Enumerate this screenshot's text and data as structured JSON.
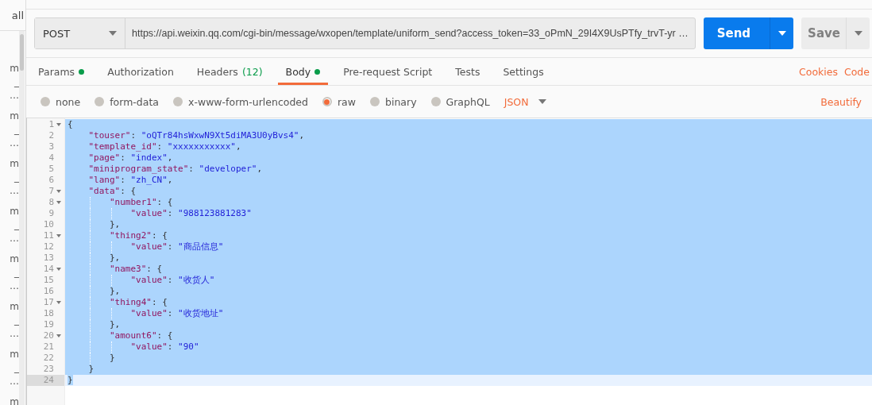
{
  "sidebar": {
    "header": "all",
    "items": [
      {
        "lines": [
          "m",
          "_",
          "…"
        ]
      },
      {
        "lines": [
          "m",
          "_",
          "…"
        ]
      },
      {
        "lines": [
          "m",
          "_",
          "…"
        ]
      },
      {
        "lines": [
          "m",
          "_",
          "…"
        ]
      },
      {
        "lines": [
          "m",
          "_",
          "…"
        ]
      },
      {
        "lines": [
          "m",
          "_",
          "…"
        ]
      },
      {
        "lines": [
          "m",
          "_",
          "…"
        ]
      },
      {
        "lines": [
          "m"
        ]
      }
    ]
  },
  "request": {
    "method": "POST",
    "url": "https://api.weixin.qq.com/cgi-bin/message/wxopen/template/uniform_send?access_token=33_oPmN_29I4X9UsPTfy_trvT-yr …",
    "send": "Send",
    "save": "Save"
  },
  "tabs": [
    {
      "label": "Params",
      "dot": true,
      "selected": false
    },
    {
      "label": "Authorization",
      "dot": false,
      "selected": false
    },
    {
      "label": "Headers",
      "count": "(12)",
      "dot": false,
      "selected": false
    },
    {
      "label": "Body",
      "dot": true,
      "selected": true
    },
    {
      "label": "Pre-request Script",
      "dot": false,
      "selected": false
    },
    {
      "label": "Tests",
      "dot": false,
      "selected": false
    },
    {
      "label": "Settings",
      "dot": false,
      "selected": false
    }
  ],
  "tab_links": [
    "Cookies",
    "Code"
  ],
  "body_types": [
    {
      "label": "none",
      "selected": false
    },
    {
      "label": "form-data",
      "selected": false
    },
    {
      "label": "x-www-form-urlencoded",
      "selected": false
    },
    {
      "label": "raw",
      "selected": true
    },
    {
      "label": "binary",
      "selected": false
    },
    {
      "label": "GraphQL",
      "selected": false
    }
  ],
  "format": "JSON",
  "beautify": "Beautify",
  "editor": {
    "lines": [
      {
        "number": "1",
        "fold": true,
        "selected": true,
        "current": false,
        "tokens": [
          {
            "kind": "punct",
            "text": "{"
          }
        ]
      },
      {
        "number": "2",
        "fold": false,
        "selected": true,
        "current": false,
        "tokens": [
          {
            "kind": "key",
            "text": "    \"touser\""
          },
          {
            "kind": "punct",
            "text": ": "
          },
          {
            "kind": "string",
            "text": "\"oQTr84hsWxwN9Xt5diMA3U0yBvs4\""
          },
          {
            "kind": "punct",
            "text": ","
          }
        ]
      },
      {
        "number": "3",
        "fold": false,
        "selected": true,
        "current": false,
        "tokens": [
          {
            "kind": "key",
            "text": "    \"template_id\""
          },
          {
            "kind": "punct",
            "text": ": "
          },
          {
            "kind": "string",
            "text": "\"xxxxxxxxxxx\""
          },
          {
            "kind": "punct",
            "text": ","
          }
        ]
      },
      {
        "number": "4",
        "fold": false,
        "selected": true,
        "current": false,
        "tokens": [
          {
            "kind": "key",
            "text": "    \"page\""
          },
          {
            "kind": "punct",
            "text": ": "
          },
          {
            "kind": "string",
            "text": "\"index\""
          },
          {
            "kind": "punct",
            "text": ","
          }
        ]
      },
      {
        "number": "5",
        "fold": false,
        "selected": true,
        "current": false,
        "tokens": [
          {
            "kind": "key",
            "text": "    \"miniprogram_state\""
          },
          {
            "kind": "punct",
            "text": ": "
          },
          {
            "kind": "string",
            "text": "\"developer\""
          },
          {
            "kind": "punct",
            "text": ","
          }
        ]
      },
      {
        "number": "6",
        "fold": false,
        "selected": true,
        "current": false,
        "tokens": [
          {
            "kind": "key",
            "text": "    \"lang\""
          },
          {
            "kind": "punct",
            "text": ": "
          },
          {
            "kind": "string",
            "text": "\"zh_CN\""
          },
          {
            "kind": "punct",
            "text": ","
          }
        ]
      },
      {
        "number": "7",
        "fold": true,
        "selected": true,
        "current": false,
        "tokens": [
          {
            "kind": "key",
            "text": "    \"data\""
          },
          {
            "kind": "punct",
            "text": ": {"
          }
        ]
      },
      {
        "number": "8",
        "fold": true,
        "selected": true,
        "current": false,
        "tokens": [
          {
            "kind": "key",
            "text": "        \"number1\""
          },
          {
            "kind": "punct",
            "text": ": {"
          }
        ]
      },
      {
        "number": "9",
        "fold": false,
        "selected": true,
        "current": false,
        "tokens": [
          {
            "kind": "key",
            "text": "            \"value\""
          },
          {
            "kind": "punct",
            "text": ": "
          },
          {
            "kind": "string",
            "text": "\"988123881283\""
          }
        ]
      },
      {
        "number": "10",
        "fold": false,
        "selected": true,
        "current": false,
        "tokens": [
          {
            "kind": "punct",
            "text": "        },"
          }
        ]
      },
      {
        "number": "11",
        "fold": true,
        "selected": true,
        "current": false,
        "tokens": [
          {
            "kind": "key",
            "text": "        \"thing2\""
          },
          {
            "kind": "punct",
            "text": ": {"
          }
        ]
      },
      {
        "number": "12",
        "fold": false,
        "selected": true,
        "current": false,
        "tokens": [
          {
            "kind": "key",
            "text": "            \"value\""
          },
          {
            "kind": "punct",
            "text": ": "
          },
          {
            "kind": "string",
            "text": "\"商品信息\""
          }
        ]
      },
      {
        "number": "13",
        "fold": false,
        "selected": true,
        "current": false,
        "tokens": [
          {
            "kind": "punct",
            "text": "        },"
          }
        ]
      },
      {
        "number": "14",
        "fold": true,
        "selected": true,
        "current": false,
        "tokens": [
          {
            "kind": "key",
            "text": "        \"name3\""
          },
          {
            "kind": "punct",
            "text": ": {"
          }
        ]
      },
      {
        "number": "15",
        "fold": false,
        "selected": true,
        "current": false,
        "tokens": [
          {
            "kind": "key",
            "text": "            \"value\""
          },
          {
            "kind": "punct",
            "text": ": "
          },
          {
            "kind": "string",
            "text": "\"收货人\""
          }
        ]
      },
      {
        "number": "16",
        "fold": false,
        "selected": true,
        "current": false,
        "tokens": [
          {
            "kind": "punct",
            "text": "        },"
          }
        ]
      },
      {
        "number": "17",
        "fold": true,
        "selected": true,
        "current": false,
        "tokens": [
          {
            "kind": "key",
            "text": "        \"thing4\""
          },
          {
            "kind": "punct",
            "text": ": {"
          }
        ]
      },
      {
        "number": "18",
        "fold": false,
        "selected": true,
        "current": false,
        "tokens": [
          {
            "kind": "key",
            "text": "            \"value\""
          },
          {
            "kind": "punct",
            "text": ": "
          },
          {
            "kind": "string",
            "text": "\"收货地址\""
          }
        ]
      },
      {
        "number": "19",
        "fold": false,
        "selected": true,
        "current": false,
        "tokens": [
          {
            "kind": "punct",
            "text": "        },"
          }
        ]
      },
      {
        "number": "20",
        "fold": true,
        "selected": true,
        "current": false,
        "tokens": [
          {
            "kind": "key",
            "text": "        \"amount6\""
          },
          {
            "kind": "punct",
            "text": ": {"
          }
        ]
      },
      {
        "number": "21",
        "fold": false,
        "selected": true,
        "current": false,
        "tokens": [
          {
            "kind": "key",
            "text": "            \"value\""
          },
          {
            "kind": "punct",
            "text": ": "
          },
          {
            "kind": "string",
            "text": "\"90\""
          }
        ]
      },
      {
        "number": "22",
        "fold": false,
        "selected": true,
        "current": false,
        "tokens": [
          {
            "kind": "punct",
            "text": "        }"
          }
        ]
      },
      {
        "number": "23",
        "fold": false,
        "selected": true,
        "current": false,
        "tokens": [
          {
            "kind": "punct",
            "text": "    }"
          }
        ]
      },
      {
        "number": "24",
        "fold": false,
        "selected": false,
        "current": true,
        "tokens": [
          {
            "kind": "punct",
            "text": "}"
          }
        ]
      }
    ]
  }
}
